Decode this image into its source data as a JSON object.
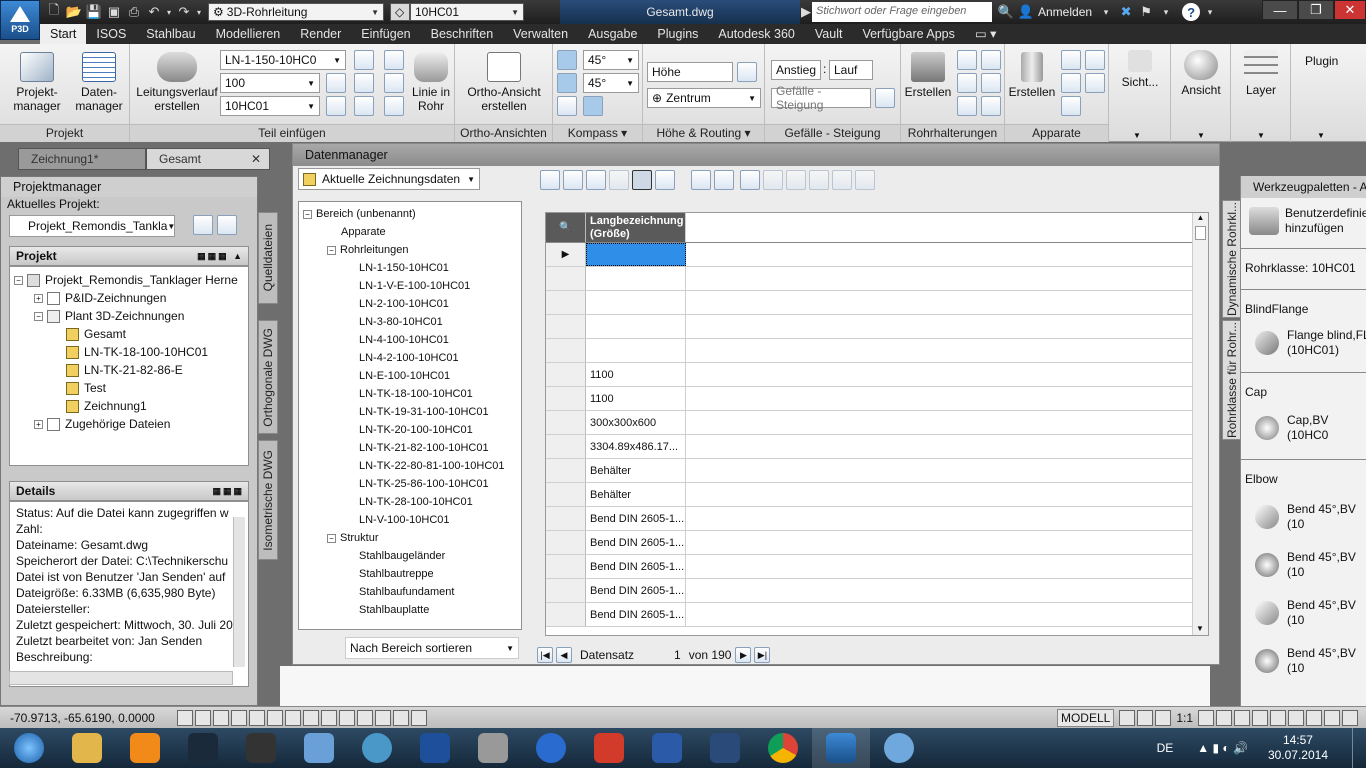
{
  "titlebar": {
    "workspace": "3D-Rohrleitung",
    "layer": "10HC01",
    "document": "Gesamt.dwg",
    "search_placeholder": "Stichwort oder Frage eingeben",
    "signin": "Anmelden"
  },
  "logo": "P3D",
  "ribbon_tabs": [
    "Start",
    "ISOS",
    "Stahlbau",
    "Modellieren",
    "Render",
    "Einfügen",
    "Beschriften",
    "Verwalten",
    "Ausgabe",
    "Plugins",
    "Autodesk 360",
    "Vault",
    "Verfügbare Apps"
  ],
  "ribbon": {
    "projekt": {
      "btn1": "Projekt-\nmanager",
      "btn2": "Daten-\nmanager",
      "title": "Projekt"
    },
    "teil": {
      "leitungsverlauf": "Leitungsverlauf\nerstellen",
      "line_combo": "LN-1-150-10HC0",
      "size_combo": "100",
      "spec_combo": "10HC01",
      "linie": "Linie in\nRohr",
      "title": "Teil einfügen"
    },
    "ortho": {
      "btn": "Ortho-Ansicht\nerstellen",
      "title": "Ortho-Ansichten"
    },
    "kompass": {
      "angle1": "45°",
      "angle2": "45°",
      "title": "Kompass"
    },
    "hoehe": {
      "hoehe": "Höhe",
      "zentrum": "Zentrum",
      "title": "Höhe & Routing"
    },
    "gefaelle": {
      "anstieg": "Anstieg",
      "sep": ":",
      "lauf": "Lauf",
      "gefaelle_combo": "Gefälle - Steigung",
      "title": "Gefälle - Steigung"
    },
    "halter": {
      "btn": "Erstellen",
      "title": "Rohrhalterungen"
    },
    "apparate": {
      "btn": "Erstellen",
      "title": "Apparate"
    },
    "sicht": {
      "btn": "Sicht..."
    },
    "ansicht": {
      "btn": "Ansicht"
    },
    "layer": {
      "btn": "Layer"
    },
    "plugin": {
      "btn": "Plugin"
    }
  },
  "doc_tabs": [
    "Zeichnung1*",
    "Gesamt"
  ],
  "project_manager": {
    "title": "Projektmanager",
    "current_label": "Aktuelles Projekt:",
    "current_project": "Projekt_Remondis_Tankla",
    "section": "Projekt",
    "tree": {
      "root": "Projekt_Remondis_Tanklager Herne",
      "pid": "P&ID-Zeichnungen",
      "plant3d": "Plant 3D-Zeichnungen",
      "drawings": [
        "Gesamt",
        "LN-TK-18-100-10HC01",
        "LN-TK-21-82-86-E",
        "Test",
        "Zeichnung1"
      ],
      "related": "Zugehörige Dateien"
    },
    "details_title": "Details",
    "details": [
      "Status: Auf die Datei kann zugegriffen w",
      "Zahl:",
      "Dateiname: Gesamt.dwg",
      "Speicherort der Datei: C:\\Technikerschu",
      "Datei ist von Benutzer 'Jan Senden' auf",
      "Dateigröße: 6.33MB (6,635,980 Byte)",
      "Dateiersteller:",
      "Zuletzt gespeichert: Mittwoch, 30. Juli 20",
      "Zuletzt bearbeitet von: Jan Senden",
      "Beschreibung:"
    ]
  },
  "vertical_tabs": [
    "Quelldateien",
    "Orthogonale DWG",
    "Isometrische DWG"
  ],
  "datamanager": {
    "title": "Datenmanager",
    "source_combo": "Aktuelle Zeichnungsdaten",
    "tree": {
      "root": "Bereich (unbenannt)",
      "apparate": "Apparate",
      "rohrleitungen": "Rohrleitungen",
      "lines": [
        "LN-1-150-10HC01",
        "LN-1-V-E-100-10HC01",
        "LN-2-100-10HC01",
        "LN-3-80-10HC01",
        "LN-4-100-10HC01",
        "LN-4-2-100-10HC01",
        "LN-E-100-10HC01",
        "LN-TK-18-100-10HC01",
        "LN-TK-19-31-100-10HC01",
        "LN-TK-20-100-10HC01",
        "LN-TK-21-82-100-10HC01",
        "LN-TK-22-80-81-100-10HC01",
        "LN-TK-25-86-100-10HC01",
        "LN-TK-28-100-10HC01",
        "LN-V-100-10HC01"
      ],
      "struktur": "Struktur",
      "struktur_items": [
        "Stahlbaugeländer",
        "Stahlbautreppe",
        "Stahlbaufundament",
        "Stahlbauplatte"
      ]
    },
    "sort_combo": "Nach Bereich sortieren",
    "grid_header": "Langbezeichnung\n(Größe)",
    "grid_rows": [
      "",
      "",
      "",
      "",
      "",
      "1100",
      "1100",
      "300x300x600",
      "3304.89x486.17...",
      "Behälter",
      "Behälter",
      "Bend DIN 2605-1...",
      "Bend DIN 2605-1...",
      "Bend DIN 2605-1...",
      "Bend DIN 2605-1...",
      "Bend DIN 2605-1..."
    ],
    "nav_label": "Datensatz",
    "nav_record": "1",
    "nav_of": "von 190"
  },
  "toolpalette": {
    "title": "Werkzeugpaletten - A",
    "side_tabs": [
      "Dynamische Rohrkl...",
      "Rohrklasse für Rohr..."
    ],
    "add_item": "Benutzerdefinie\nhinzufügen",
    "rohrklasse": "Rohrklasse: 10HC01",
    "blind_head": "BlindFlange",
    "blind_item": "Flange blind,FL\n(10HC01)",
    "cap_head": "Cap",
    "cap_item": "Cap,BV (10HC0",
    "elbow_head": "Elbow",
    "elbow_items": [
      "Bend 45°,BV (10",
      "Bend 45°,BV (10",
      "Bend 45°,BV (10",
      "Bend 45°,BV (10"
    ]
  },
  "statusbar": {
    "coords": "-70.9713, -65.6190, 0.0000",
    "modell": "MODELL",
    "scale": "1:1"
  },
  "taskbar": {
    "lang": "DE",
    "time": "14:57",
    "date": "30.07.2014"
  },
  "colors": {
    "accent": "#3d8ad6",
    "selection": "#2f8fe8",
    "ribbon": "#e9e9e9",
    "taskbar": "#1e3a54"
  }
}
